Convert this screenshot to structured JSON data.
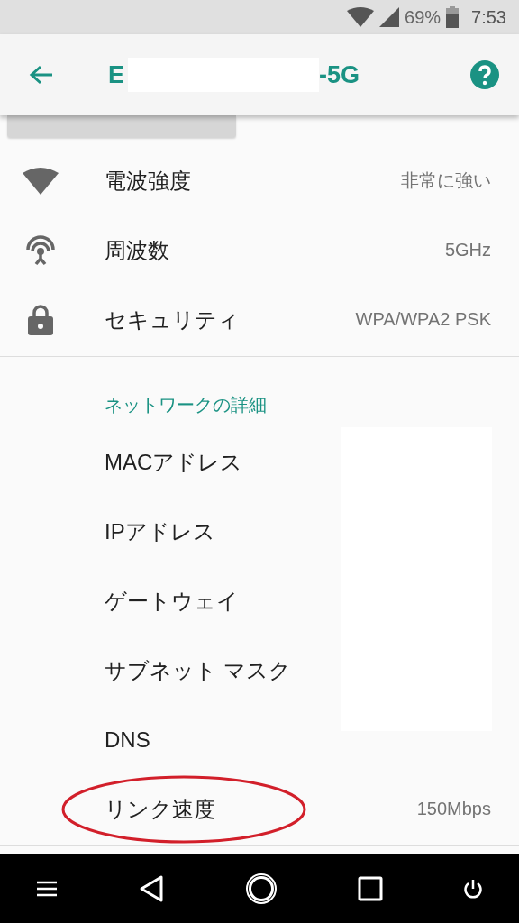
{
  "status_bar": {
    "battery": "69%",
    "time": "7:53"
  },
  "toolbar": {
    "title_start": "E",
    "title_end": "-5G"
  },
  "info_rows": [
    {
      "kind": "signal",
      "label": "電波強度",
      "value": "非常に強い"
    },
    {
      "kind": "frequency",
      "label": "周波数",
      "value": "5GHz"
    },
    {
      "kind": "security",
      "label": "セキュリティ",
      "value": "WPA/WPA2 PSK"
    }
  ],
  "details": {
    "header": "ネットワークの詳細",
    "rows": [
      {
        "label": "MACアドレス",
        "highlighted": false
      },
      {
        "label": "IPアドレス",
        "highlighted": false
      },
      {
        "label": "ゲートウェイ",
        "highlighted": false
      },
      {
        "label": "サブネット マスク",
        "highlighted": false
      },
      {
        "label": "DNS",
        "highlighted": false
      },
      {
        "label": "リンク速度",
        "value": "150Mbps",
        "highlighted": true
      }
    ]
  }
}
